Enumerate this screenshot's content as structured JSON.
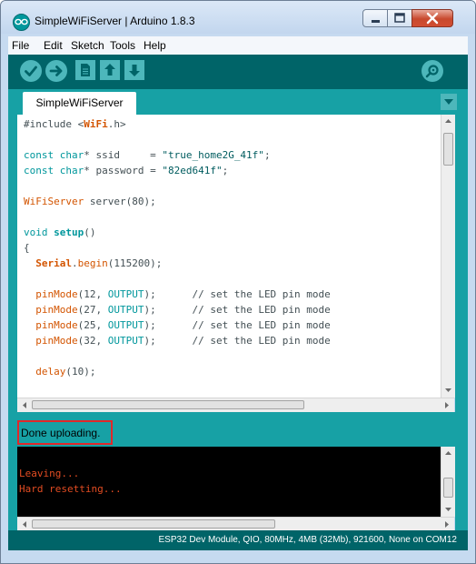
{
  "window": {
    "title": "SimpleWiFiServer | Arduino 1.8.3",
    "app_icon": "arduino-logo-icon"
  },
  "menubar": {
    "items": [
      "File",
      "Edit",
      "Sketch",
      "Tools",
      "Help"
    ]
  },
  "toolbar": {
    "buttons": [
      "verify-icon",
      "upload-icon",
      "new-icon",
      "open-icon",
      "save-icon",
      "serial-monitor-icon"
    ]
  },
  "tabs": [
    {
      "label": "SimpleWiFiServer",
      "active": true
    }
  ],
  "editor": {
    "lines": [
      "#include <WiFi.h>",
      "",
      "const char* ssid     = \"true_home2G_41f\";",
      "const char* password = \"82ed641f\";",
      "",
      "WiFiServer server(80);",
      "",
      "void setup()",
      "{",
      "  Serial.begin(115200);",
      "",
      "  pinMode(12, OUTPUT);      // set the LED pin mode",
      "  pinMode(27, OUTPUT);      // set the LED pin mode",
      "  pinMode(25, OUTPUT);      // set the LED pin mode",
      "  pinMode(32, OUTPUT);      // set the LED pin mode",
      "",
      "  delay(10);"
    ]
  },
  "status": {
    "message": "Done uploading."
  },
  "console": {
    "lines": [
      "Leaving...",
      "Hard resetting..."
    ]
  },
  "footer": {
    "board_info": "ESP32 Dev Module, QIO, 80MHz, 4MB (32Mb), 921600, None on COM12"
  },
  "colors": {
    "toolbar": "#006468",
    "teal": "#17a1a5",
    "console_text": "#e34c22",
    "highlight_box": "#e1282a"
  }
}
